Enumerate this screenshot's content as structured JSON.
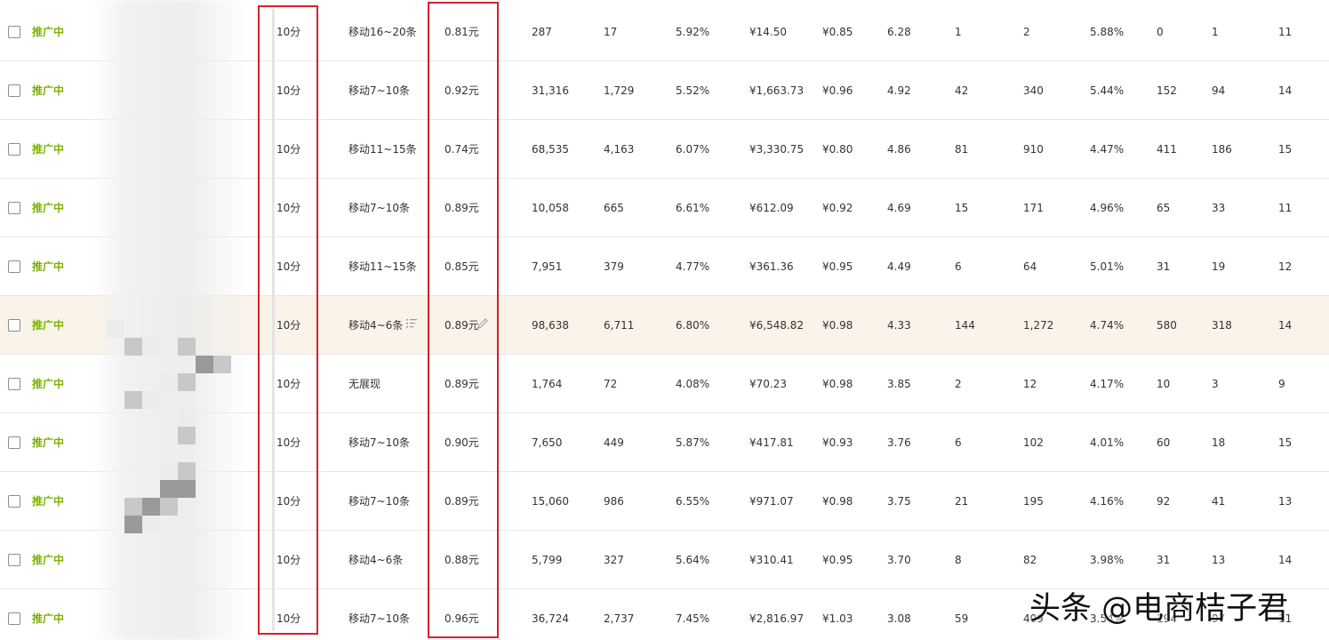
{
  "table": {
    "rows": [
      {
        "status": "推广中",
        "time_slot": "10分",
        "position": "移动16~20条",
        "bid": "0.81元",
        "impressions": "287",
        "clicks": "17",
        "ctr": "5.92%",
        "cost": "¥14.50",
        "cpc": "¥0.85",
        "score": "6.28",
        "col1": "1",
        "col2": "2",
        "col3": "5.88%",
        "col4": "0",
        "col5": "1",
        "col6": "11"
      },
      {
        "status": "推广中",
        "time_slot": "10分",
        "position": "移动7~10条",
        "bid": "0.92元",
        "impressions": "31,316",
        "clicks": "1,729",
        "ctr": "5.52%",
        "cost": "¥1,663.73",
        "cpc": "¥0.96",
        "score": "4.92",
        "col1": "42",
        "col2": "340",
        "col3": "5.44%",
        "col4": "152",
        "col5": "94",
        "col6": "14"
      },
      {
        "status": "推广中",
        "time_slot": "10分",
        "position": "移动11~15条",
        "bid": "0.74元",
        "impressions": "68,535",
        "clicks": "4,163",
        "ctr": "6.07%",
        "cost": "¥3,330.75",
        "cpc": "¥0.80",
        "score": "4.86",
        "col1": "81",
        "col2": "910",
        "col3": "4.47%",
        "col4": "411",
        "col5": "186",
        "col6": "15"
      },
      {
        "status": "推广中",
        "time_slot": "10分",
        "position": "移动7~10条",
        "bid": "0.89元",
        "impressions": "10,058",
        "clicks": "665",
        "ctr": "6.61%",
        "cost": "¥612.09",
        "cpc": "¥0.92",
        "score": "4.69",
        "col1": "15",
        "col2": "171",
        "col3": "4.96%",
        "col4": "65",
        "col5": "33",
        "col6": "11"
      },
      {
        "status": "推广中",
        "time_slot": "10分",
        "position": "移动11~15条",
        "bid": "0.85元",
        "impressions": "7,951",
        "clicks": "379",
        "ctr": "4.77%",
        "cost": "¥361.36",
        "cpc": "¥0.95",
        "score": "4.49",
        "col1": "6",
        "col2": "64",
        "col3": "5.01%",
        "col4": "31",
        "col5": "19",
        "col6": "12"
      },
      {
        "status": "推广中",
        "time_slot": "10分",
        "position": "移动4~6条",
        "bid": "0.89元",
        "impressions": "98,638",
        "clicks": "6,711",
        "ctr": "6.80%",
        "cost": "¥6,548.82",
        "cpc": "¥0.98",
        "score": "4.33",
        "col1": "144",
        "col2": "1,272",
        "col3": "4.74%",
        "col4": "580",
        "col5": "318",
        "col6": "14"
      },
      {
        "status": "推广中",
        "time_slot": "10分",
        "position": "无展现",
        "bid": "0.89元",
        "impressions": "1,764",
        "clicks": "72",
        "ctr": "4.08%",
        "cost": "¥70.23",
        "cpc": "¥0.98",
        "score": "3.85",
        "col1": "2",
        "col2": "12",
        "col3": "4.17%",
        "col4": "10",
        "col5": "3",
        "col6": "9"
      },
      {
        "status": "推广中",
        "time_slot": "10分",
        "position": "移动7~10条",
        "bid": "0.90元",
        "impressions": "7,650",
        "clicks": "449",
        "ctr": "5.87%",
        "cost": "¥417.81",
        "cpc": "¥0.93",
        "score": "3.76",
        "col1": "6",
        "col2": "102",
        "col3": "4.01%",
        "col4": "60",
        "col5": "18",
        "col6": "15"
      },
      {
        "status": "推广中",
        "time_slot": "10分",
        "position": "移动7~10条",
        "bid": "0.89元",
        "impressions": "15,060",
        "clicks": "986",
        "ctr": "6.55%",
        "cost": "¥971.07",
        "cpc": "¥0.98",
        "score": "3.75",
        "col1": "21",
        "col2": "195",
        "col3": "4.16%",
        "col4": "92",
        "col5": "41",
        "col6": "13"
      },
      {
        "status": "推广中",
        "time_slot": "10分",
        "position": "移动4~6条",
        "bid": "0.88元",
        "impressions": "5,799",
        "clicks": "327",
        "ctr": "5.64%",
        "cost": "¥310.41",
        "cpc": "¥0.95",
        "score": "3.70",
        "col1": "8",
        "col2": "82",
        "col3": "3.98%",
        "col4": "31",
        "col5": "13",
        "col6": "14"
      },
      {
        "status": "推广中",
        "time_slot": "10分",
        "position": "移动7~10条",
        "bid": "0.96元",
        "impressions": "36,724",
        "clicks": "2,737",
        "ctr": "7.45%",
        "cost": "¥2,816.97",
        "cpc": "¥1.03",
        "score": "3.08",
        "col1": "59",
        "col2": "409",
        "col3": "3.54%",
        "col4": "194",
        "col5": "97",
        "col6": "11"
      }
    ]
  },
  "watermark": {
    "text": "头条 @电商桔子君"
  },
  "colors": {
    "status_green": "#7cb305",
    "highlight_row": "#faf3ea",
    "annotation_red": "#d8212b"
  },
  "icons": {
    "list": "list-settings-icon",
    "edit": "pencil-icon"
  }
}
